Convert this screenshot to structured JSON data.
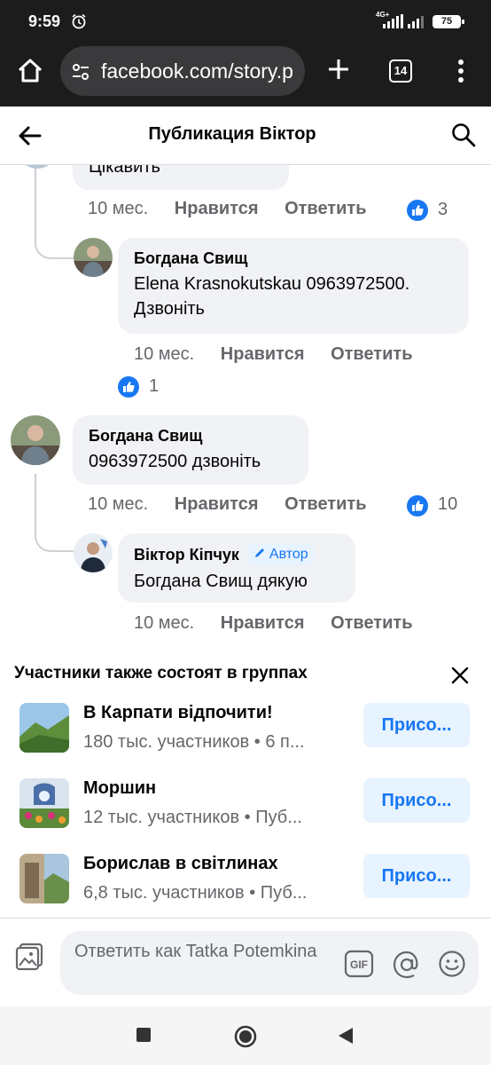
{
  "status_bar": {
    "time": "9:59",
    "network": "4G+",
    "battery": "75"
  },
  "browser": {
    "url": "facebook.com/story.p",
    "tabs_count": "14"
  },
  "header": {
    "title": "Публикация Віктор"
  },
  "comments": {
    "c0": {
      "text": "Цікавить",
      "time": "10 мес.",
      "like": "Нравится",
      "reply": "Ответить",
      "reactions": "3"
    },
    "c1": {
      "author": "Богдана Свищ",
      "text": "Elena  Krasnokutskau 0963972500. Дзвоніть",
      "time": "10 мес.",
      "like": "Нравится",
      "reply": "Ответить",
      "reactions": "1"
    },
    "c2": {
      "author": "Богдана Свищ",
      "text": "0963972500 дзвоніть",
      "time": "10 мес.",
      "like": "Нравится",
      "reply": "Ответить",
      "reactions": "10"
    },
    "c3": {
      "author": "Віктор Кіпчук",
      "badge": "Автор",
      "text": "Богдана Свищ дякую",
      "time": "10 мес.",
      "like": "Нравится",
      "reply": "Ответить"
    }
  },
  "groups": {
    "title": "Участники также состоят в группах",
    "items": [
      {
        "name": "В Карпати відпочити!",
        "meta": "180 тыс. участников • 6 п...",
        "join": "Присо..."
      },
      {
        "name": "Моршин",
        "meta": "12 тыс. участников • Пуб...",
        "join": "Присо..."
      },
      {
        "name": "Борислав в світлинах",
        "meta": "6,8 тыс. участников • Пуб...",
        "join": "Присо..."
      }
    ]
  },
  "composer": {
    "placeholder": "Ответить как Tatka Potemkina"
  },
  "colors": {
    "brand": "#1877f2",
    "bubble": "#f0f2f5",
    "secondary_text": "#65676b"
  }
}
